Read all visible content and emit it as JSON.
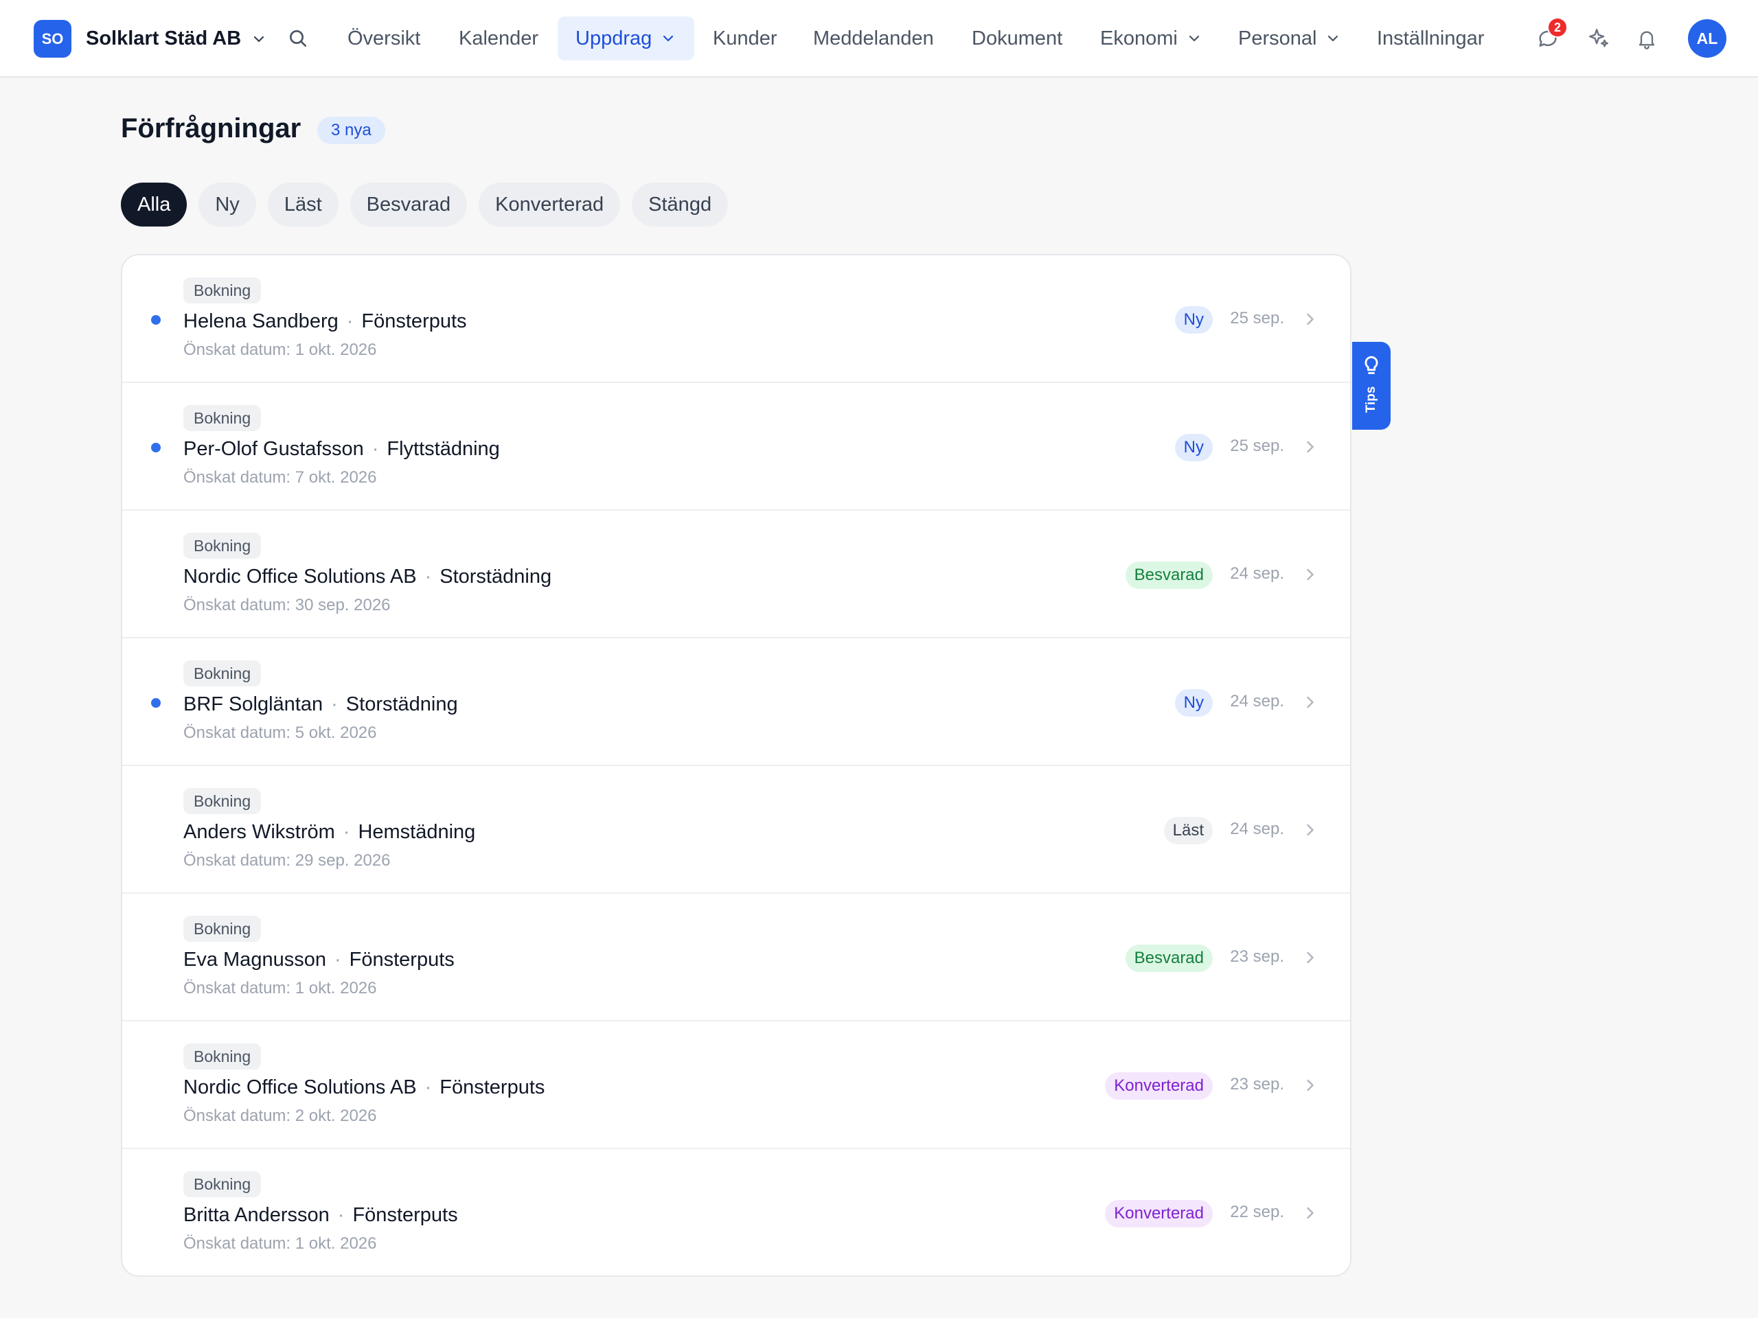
{
  "app": {
    "logo_initials": "SO",
    "company_name": "Solklart Städ AB"
  },
  "nav": {
    "items": [
      {
        "label": "Översikt"
      },
      {
        "label": "Kalender"
      },
      {
        "label": "Uppdrag",
        "active": true
      },
      {
        "label": "Kunder"
      },
      {
        "label": "Meddelanden"
      },
      {
        "label": "Dokument"
      },
      {
        "label": "Ekonomi"
      },
      {
        "label": "Personal"
      },
      {
        "label": "Inställningar"
      }
    ]
  },
  "header_actions": {
    "messages_badge": "2",
    "avatar_initials": "AL"
  },
  "page": {
    "title": "Förfrågningar",
    "new_count_badge": "3 nya"
  },
  "filters": [
    "Alla",
    "Ny",
    "Läst",
    "Besvarad",
    "Konverterad",
    "Stängd"
  ],
  "active_filter": "Alla",
  "status_colors": {
    "Ny": "#1d4ed8",
    "Besvarad": "#15803d",
    "Läst": "#374151",
    "Konverterad": "#7e22ce"
  },
  "requests": [
    {
      "type": "Bokning",
      "customer": "Helena Sandberg",
      "service": "Fönsterputs",
      "desired_date": "Önskat datum: 1 okt. 2026",
      "status": "Ny",
      "date": "25 sep.",
      "unread": true
    },
    {
      "type": "Bokning",
      "customer": "Per-Olof Gustafsson",
      "service": "Flyttstädning",
      "desired_date": "Önskat datum: 7 okt. 2026",
      "status": "Ny",
      "date": "25 sep.",
      "unread": true
    },
    {
      "type": "Bokning",
      "customer": "Nordic Office Solutions AB",
      "service": "Storstädning",
      "desired_date": "Önskat datum: 30 sep. 2026",
      "status": "Besvarad",
      "date": "24 sep.",
      "unread": false
    },
    {
      "type": "Bokning",
      "customer": "BRF Solgläntan",
      "service": "Storstädning",
      "desired_date": "Önskat datum: 5 okt. 2026",
      "status": "Ny",
      "date": "24 sep.",
      "unread": true
    },
    {
      "type": "Bokning",
      "customer": "Anders Wikström",
      "service": "Hemstädning",
      "desired_date": "Önskat datum: 29 sep. 2026",
      "status": "Läst",
      "date": "24 sep.",
      "unread": false
    },
    {
      "type": "Bokning",
      "customer": "Eva Magnusson",
      "service": "Fönsterputs",
      "desired_date": "Önskat datum: 1 okt. 2026",
      "status": "Besvarad",
      "date": "23 sep.",
      "unread": false
    },
    {
      "type": "Bokning",
      "customer": "Nordic Office Solutions AB",
      "service": "Fönsterputs",
      "desired_date": "Önskat datum: 2 okt. 2026",
      "status": "Konverterad",
      "date": "23 sep.",
      "unread": false
    },
    {
      "type": "Bokning",
      "customer": "Britta Andersson",
      "service": "Fönsterputs",
      "desired_date": "Önskat datum: 1 okt. 2026",
      "status": "Konverterad",
      "date": "22 sep.",
      "unread": false
    }
  ],
  "tips_tab": {
    "label": "Tips",
    "icon": "lightbulb-icon"
  },
  "icons": {
    "search": "search-icon",
    "messages": "chat-bubble-icon",
    "assistant": "sparkles-icon",
    "notifications": "bell-icon",
    "row_open": "chevron-right-icon"
  }
}
